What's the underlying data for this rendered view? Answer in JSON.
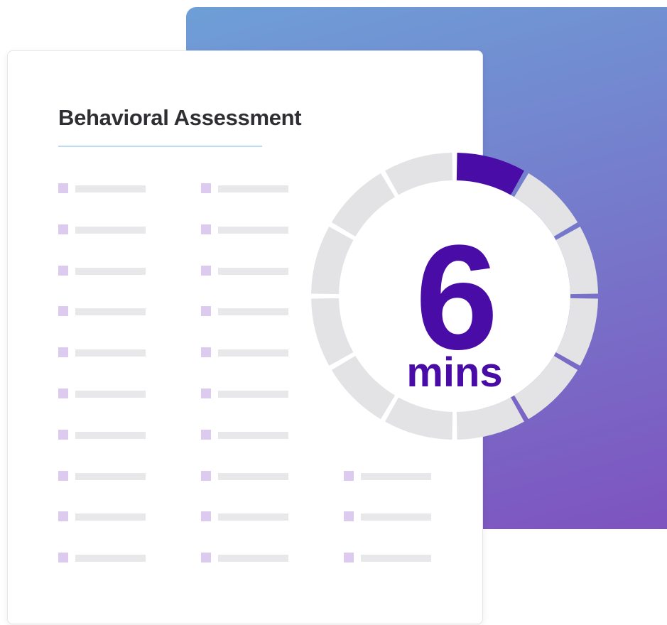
{
  "colors": {
    "gradient_top": "#6e9fd7",
    "gradient_bottom": "#7e53bf",
    "accent": "#4a0ca6",
    "ring_gray": "#e3e3e5",
    "bullet": "#dccbef",
    "placeholder_bar": "#e8e8ea",
    "title_underline": "#bddbef"
  },
  "card": {
    "title": "Behavioral Assessment"
  },
  "timer": {
    "value": "6",
    "unit": "mins",
    "segments_total": 12,
    "segments_filled": 1
  },
  "list": {
    "rows": 10,
    "column_row_counts": [
      10,
      10,
      3
    ]
  }
}
